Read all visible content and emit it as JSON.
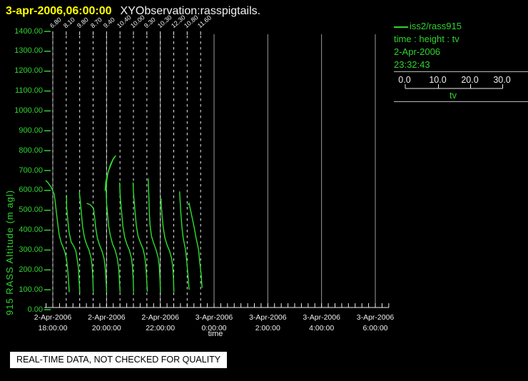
{
  "header": {
    "timestamp": "3-apr-2006,06:00:00",
    "title": "XYObservation:rasspigtails."
  },
  "colors": {
    "background": "#000000",
    "title_yellow": "#ffff00",
    "text_white": "#efefef",
    "accent_green": "#2fd32f",
    "curve_green": "#2ce02c",
    "grid_gray": "#9b9b9b"
  },
  "legend": {
    "series_label": "iss2/rass915",
    "fields_label": "time : height : tv",
    "date_label": "2-Apr-2006",
    "time_label": "23:32:43"
  },
  "scale_bar": {
    "tick_labels": [
      "0.0",
      "10.0",
      "20.0",
      "30.0"
    ],
    "values": [
      0,
      10,
      20,
      30
    ],
    "label": "tv"
  },
  "notice": {
    "text": "REAL-TIME DATA, NOT CHECKED FOR QUALITY"
  },
  "chart_data": {
    "type": "line",
    "title": "XYObservation:rasspigtails.",
    "xlabel": "time",
    "ylabel": "915 RASS Altitude (m agl)",
    "ylim": [
      0,
      1400
    ],
    "y_tick_step": 100,
    "grid": "vertical-major",
    "x_ticks": [
      {
        "date": "2-Apr-2006",
        "time": "18:00:00",
        "minutes": 0
      },
      {
        "date": "2-Apr-2006",
        "time": "20:00:00",
        "minutes": 120
      },
      {
        "date": "2-Apr-2006",
        "time": "22:00:00",
        "minutes": 240
      },
      {
        "date": "3-Apr-2006",
        "time": "0:00:00",
        "minutes": 360
      },
      {
        "date": "3-Apr-2006",
        "time": "2:00:00",
        "minutes": 480
      },
      {
        "date": "3-Apr-2006",
        "time": "4:00:00",
        "minutes": 600
      },
      {
        "date": "3-Apr-2006",
        "time": "6:00:00",
        "minutes": 720
      }
    ],
    "minor_tick_minutes": 15,
    "profiles": [
      {
        "label": "6.80",
        "minutes": 0
      },
      {
        "label": "8.10",
        "minutes": 30
      },
      {
        "label": "9.80",
        "minutes": 60
      },
      {
        "label": "8.70",
        "minutes": 90
      },
      {
        "label": "9.40",
        "minutes": 120
      },
      {
        "label": "10.40",
        "minutes": 150
      },
      {
        "label": "10.00",
        "minutes": 180
      },
      {
        "label": "9.30",
        "minutes": 210
      },
      {
        "label": "10.30",
        "minutes": 240
      },
      {
        "label": "12.30",
        "minutes": 270
      },
      {
        "label": "10.80",
        "minutes": 300
      },
      {
        "label": "11.60",
        "minutes": 330
      }
    ],
    "curves": [
      {
        "minutes": 0,
        "points": [
          [
            23,
            88
          ],
          [
            22,
            150
          ],
          [
            20.5,
            215
          ],
          [
            19,
            260
          ],
          [
            16,
            300
          ],
          [
            12,
            335
          ],
          [
            9,
            375
          ],
          [
            7,
            430
          ],
          [
            5,
            490
          ],
          [
            3.5,
            540
          ],
          [
            2,
            580
          ],
          [
            -2,
            615
          ],
          [
            -7,
            640
          ],
          [
            -10,
            650
          ]
        ]
      },
      {
        "minutes": 30,
        "points": [
          [
            19,
            86
          ],
          [
            18,
            150
          ],
          [
            17,
            215
          ],
          [
            15.5,
            250
          ],
          [
            13.5,
            295
          ],
          [
            10.5,
            320
          ],
          [
            7,
            340
          ],
          [
            4,
            390
          ],
          [
            2,
            460
          ],
          [
            0.5,
            520
          ],
          [
            0.5,
            577
          ]
        ]
      },
      {
        "minutes": 60,
        "points": [
          [
            19,
            88
          ],
          [
            18.5,
            150
          ],
          [
            17.5,
            215
          ],
          [
            16,
            260
          ],
          [
            13,
            300
          ],
          [
            9.5,
            330
          ],
          [
            6.5,
            365
          ],
          [
            4,
            420
          ],
          [
            2.5,
            480
          ],
          [
            1,
            540
          ],
          [
            0,
            575
          ],
          [
            -0.5,
            590
          ]
        ]
      },
      {
        "minutes": 90,
        "points": [
          [
            19,
            88
          ],
          [
            18,
            150
          ],
          [
            17,
            210
          ],
          [
            15.5,
            255
          ],
          [
            12.5,
            295
          ],
          [
            9,
            325
          ],
          [
            6,
            360
          ],
          [
            3.5,
            415
          ],
          [
            2,
            470
          ],
          [
            0.5,
            510
          ],
          [
            -4,
            528
          ],
          [
            -9,
            535
          ]
        ]
      },
      {
        "minutes": 120,
        "points": [
          [
            19,
            88
          ],
          [
            18,
            150
          ],
          [
            17,
            210
          ],
          [
            15,
            260
          ],
          [
            12,
            300
          ],
          [
            8.5,
            330
          ],
          [
            5.5,
            370
          ],
          [
            3,
            420
          ],
          [
            1.5,
            480
          ],
          [
            0,
            540
          ],
          [
            -0.5,
            595
          ],
          [
            0,
            640
          ],
          [
            2,
            690
          ],
          [
            5.5,
            730
          ],
          [
            9.5,
            760
          ],
          [
            13,
            775
          ],
          [
            9,
            755
          ],
          [
            3,
            700
          ],
          [
            -1,
            645
          ],
          [
            -2,
            598
          ]
        ]
      },
      {
        "minutes": 150,
        "points": [
          [
            19,
            88
          ],
          [
            18.5,
            150
          ],
          [
            17.5,
            215
          ],
          [
            16,
            260
          ],
          [
            13,
            300
          ],
          [
            9.5,
            330
          ],
          [
            6.5,
            365
          ],
          [
            4,
            420
          ],
          [
            2.5,
            480
          ],
          [
            1,
            540
          ],
          [
            0,
            590
          ],
          [
            -0.5,
            640
          ]
        ]
      },
      {
        "minutes": 180,
        "points": [
          [
            19.5,
            90
          ],
          [
            18.5,
            155
          ],
          [
            17.5,
            215
          ],
          [
            16,
            265
          ],
          [
            13.5,
            305
          ],
          [
            10,
            335
          ],
          [
            6.5,
            370
          ],
          [
            4,
            425
          ],
          [
            2.5,
            485
          ],
          [
            1,
            545
          ],
          [
            0,
            595
          ],
          [
            -0.5,
            640
          ]
        ]
      },
      {
        "minutes": 210,
        "points": [
          [
            19,
            88
          ],
          [
            18.5,
            150
          ],
          [
            17.5,
            215
          ],
          [
            16,
            260
          ],
          [
            13,
            300
          ],
          [
            9.5,
            335
          ],
          [
            6.5,
            370
          ],
          [
            4.5,
            425
          ],
          [
            3.5,
            485
          ],
          [
            3,
            545
          ],
          [
            2.5,
            600
          ],
          [
            2,
            660
          ]
        ]
      },
      {
        "minutes": 240,
        "points": [
          [
            19,
            88
          ],
          [
            18.5,
            150
          ],
          [
            17.5,
            210
          ],
          [
            16,
            255
          ],
          [
            13,
            295
          ],
          [
            9.5,
            325
          ],
          [
            6.5,
            360
          ],
          [
            4,
            415
          ],
          [
            2.5,
            470
          ],
          [
            1.5,
            520
          ],
          [
            1,
            560
          ]
        ]
      },
      {
        "minutes": 270,
        "points": [
          [
            21.5,
            100
          ],
          [
            20.8,
            134
          ],
          [
            19.8,
            182
          ],
          [
            18.2,
            242
          ],
          [
            16.5,
            302
          ],
          [
            13.2,
            362
          ],
          [
            11.5,
            415
          ],
          [
            9.8,
            493
          ],
          [
            8.2,
            595
          ]
        ]
      },
      {
        "minutes": 300,
        "points": [
          [
            21,
            110
          ],
          [
            20.5,
            130
          ],
          [
            19.5,
            182
          ],
          [
            17.5,
            242
          ],
          [
            16,
            302
          ],
          [
            12.5,
            362
          ],
          [
            9.5,
            420
          ],
          [
            6,
            480
          ],
          [
            2.7,
            535
          ],
          [
            1,
            527
          ]
        ]
      }
    ]
  }
}
